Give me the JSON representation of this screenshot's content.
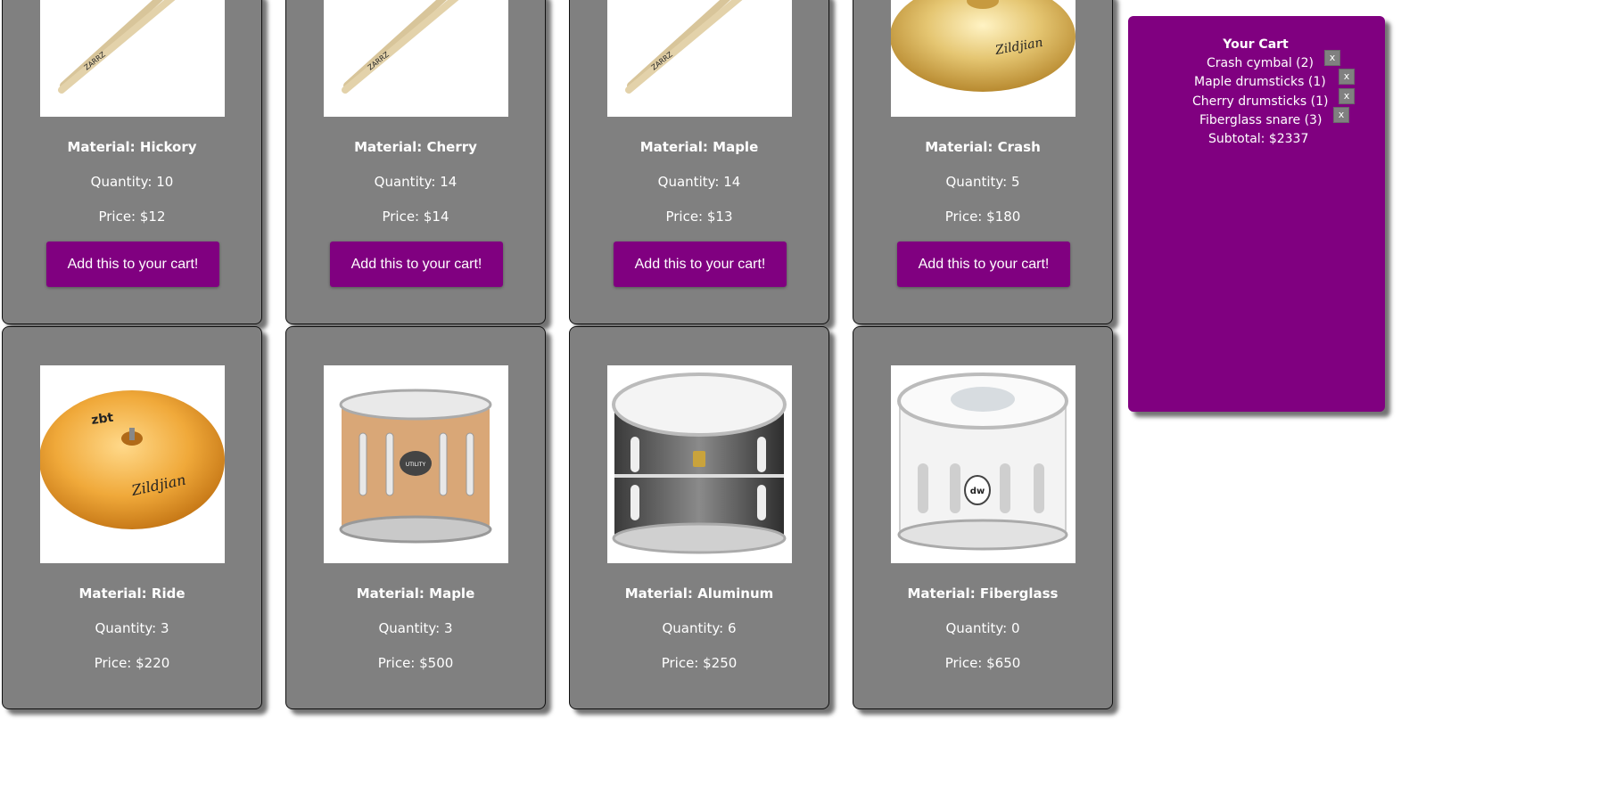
{
  "products": [
    {
      "material": "Material: Hickory",
      "quantity": "Quantity: 10",
      "price": "Price: $12",
      "button": "Add this to your cart!",
      "image": "drumsticks"
    },
    {
      "material": "Material: Cherry",
      "quantity": "Quantity: 14",
      "price": "Price: $14",
      "button": "Add this to your cart!",
      "image": "drumsticks"
    },
    {
      "material": "Material: Maple",
      "quantity": "Quantity: 14",
      "price": "Price: $13",
      "button": "Add this to your cart!",
      "image": "drumsticks"
    },
    {
      "material": "Material: Crash",
      "quantity": "Quantity: 5",
      "price": "Price: $180",
      "button": "Add this to your cart!",
      "image": "crash-cymbal"
    },
    {
      "material": "Material: Ride",
      "quantity": "Quantity: 3",
      "price": "Price: $220",
      "image": "ride-cymbal"
    },
    {
      "material": "Material: Maple",
      "quantity": "Quantity: 3",
      "price": "Price: $500",
      "image": "maple-snare"
    },
    {
      "material": "Material: Aluminum",
      "quantity": "Quantity: 6",
      "price": "Price: $250",
      "image": "aluminum-snare"
    },
    {
      "material": "Material: Fiberglass",
      "quantity": "Quantity: 0",
      "price": "Price: $650",
      "image": "fiberglass-snare"
    }
  ],
  "logo_text": {
    "drumsticks": "ZARRZ",
    "cymbal": "Zildjian",
    "ride_brand": "zbt",
    "snare_badge": "UTILITY",
    "dw": "dw"
  },
  "cart": {
    "title": "Your Cart",
    "items": [
      {
        "label": "Crash cymbal (2)",
        "remove": "x"
      },
      {
        "label": "Maple drumsticks (1)",
        "remove": "x"
      },
      {
        "label": "Cherry drumsticks (1)",
        "remove": "x"
      },
      {
        "label": "Fiberglass snare (3)",
        "remove": "x"
      }
    ],
    "subtotal": "Subtotal: $2337"
  },
  "colors": {
    "page": "#ffffff",
    "card": "#808080",
    "accent": "#800080",
    "text": "#ffffff"
  }
}
